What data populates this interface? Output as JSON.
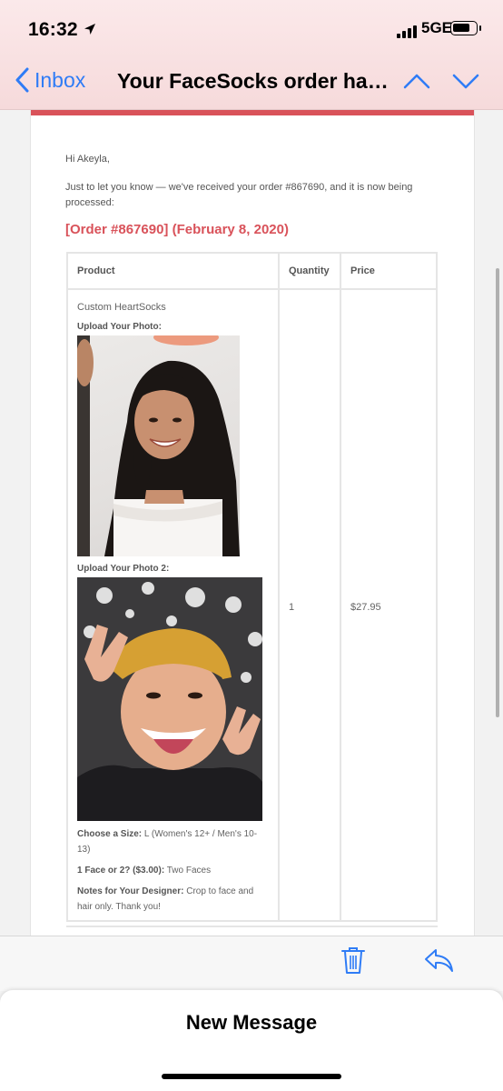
{
  "status_bar": {
    "time": "16:32",
    "network": "5GE"
  },
  "nav": {
    "back_label": "Inbox",
    "subject": "Your FaceSocks order has been received!"
  },
  "email": {
    "greeting": "Hi Akeyla,",
    "intro": "Just to let you know — we've received your order #867690, and it is now being processed:",
    "order_title": "[Order #867690] (February 8, 2020)",
    "table": {
      "headers": {
        "product": "Product",
        "quantity": "Quantity",
        "price": "Price"
      },
      "item": {
        "name": "Custom HeartSocks",
        "photo1_label": "Upload Your Photo:",
        "photo2_label": "Upload Your Photo 2:",
        "size_label": "Choose a Size:",
        "size_value": " L (Women's 12+ / Men's 10-13)",
        "faces_label": "1 Face or 2? ($3.00):",
        "faces_value": " Two Faces",
        "notes_label": "Notes for Your Designer:",
        "notes_value": " Crop to face and hair only. Thank you!",
        "quantity": "1",
        "price": "$27.95"
      }
    }
  },
  "sheet": {
    "title": "New Message"
  },
  "colors": {
    "accent_red": "#d9525a",
    "ios_blue": "#2f7cf6"
  },
  "icons": [
    "location-arrow-icon",
    "chevron-left-icon",
    "chevron-up-icon",
    "chevron-down-icon",
    "trash-icon",
    "reply-icon"
  ]
}
